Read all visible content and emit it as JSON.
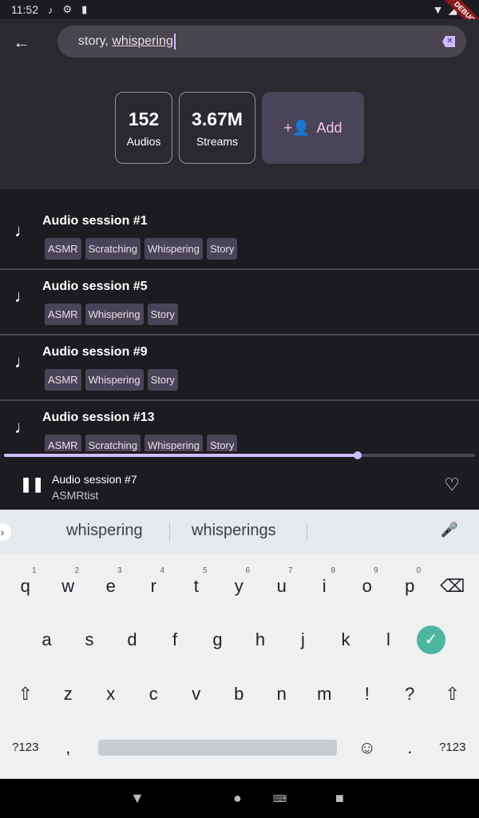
{
  "status": {
    "time": "11:52",
    "debug_banner": "DEBUG"
  },
  "search": {
    "value_plain": "story, ",
    "value_composing": "whispering"
  },
  "stats": [
    {
      "value": "152",
      "label": "Audios"
    },
    {
      "value": "3.67M",
      "label": "Streams"
    }
  ],
  "add_button": {
    "label": "Add"
  },
  "sessions": [
    {
      "title": "Audio session #1",
      "tags": [
        "ASMR",
        "Scratching",
        "Whispering",
        "Story"
      ]
    },
    {
      "title": "Audio session #5",
      "tags": [
        "ASMR",
        "Whispering",
        "Story"
      ]
    },
    {
      "title": "Audio session #9",
      "tags": [
        "ASMR",
        "Whispering",
        "Story"
      ]
    },
    {
      "title": "Audio session #13",
      "tags": [
        "ASMR",
        "Scratching",
        "Whispering",
        "Story"
      ]
    }
  ],
  "player": {
    "title": "Audio session #7",
    "artist": "ASMRtist",
    "progress": 0.75
  },
  "colors": {
    "accent": "#cfbcff",
    "chip": "#4a4458",
    "background": "#1c1b1f"
  },
  "keyboard": {
    "suggestions": [
      "whispering",
      "whisperings"
    ],
    "row1": [
      "q",
      "w",
      "e",
      "r",
      "t",
      "y",
      "u",
      "i",
      "o",
      "p"
    ],
    "row1_hints": [
      "1",
      "2",
      "3",
      "4",
      "5",
      "6",
      "7",
      "8",
      "9",
      "0"
    ],
    "row2": [
      "a",
      "s",
      "d",
      "f",
      "g",
      "h",
      "j",
      "k",
      "l"
    ],
    "row3": [
      "z",
      "x",
      "c",
      "v",
      "b",
      "n",
      "m",
      "!",
      "?"
    ],
    "symbols_label": "?123",
    "comma": ",",
    "period": "."
  }
}
